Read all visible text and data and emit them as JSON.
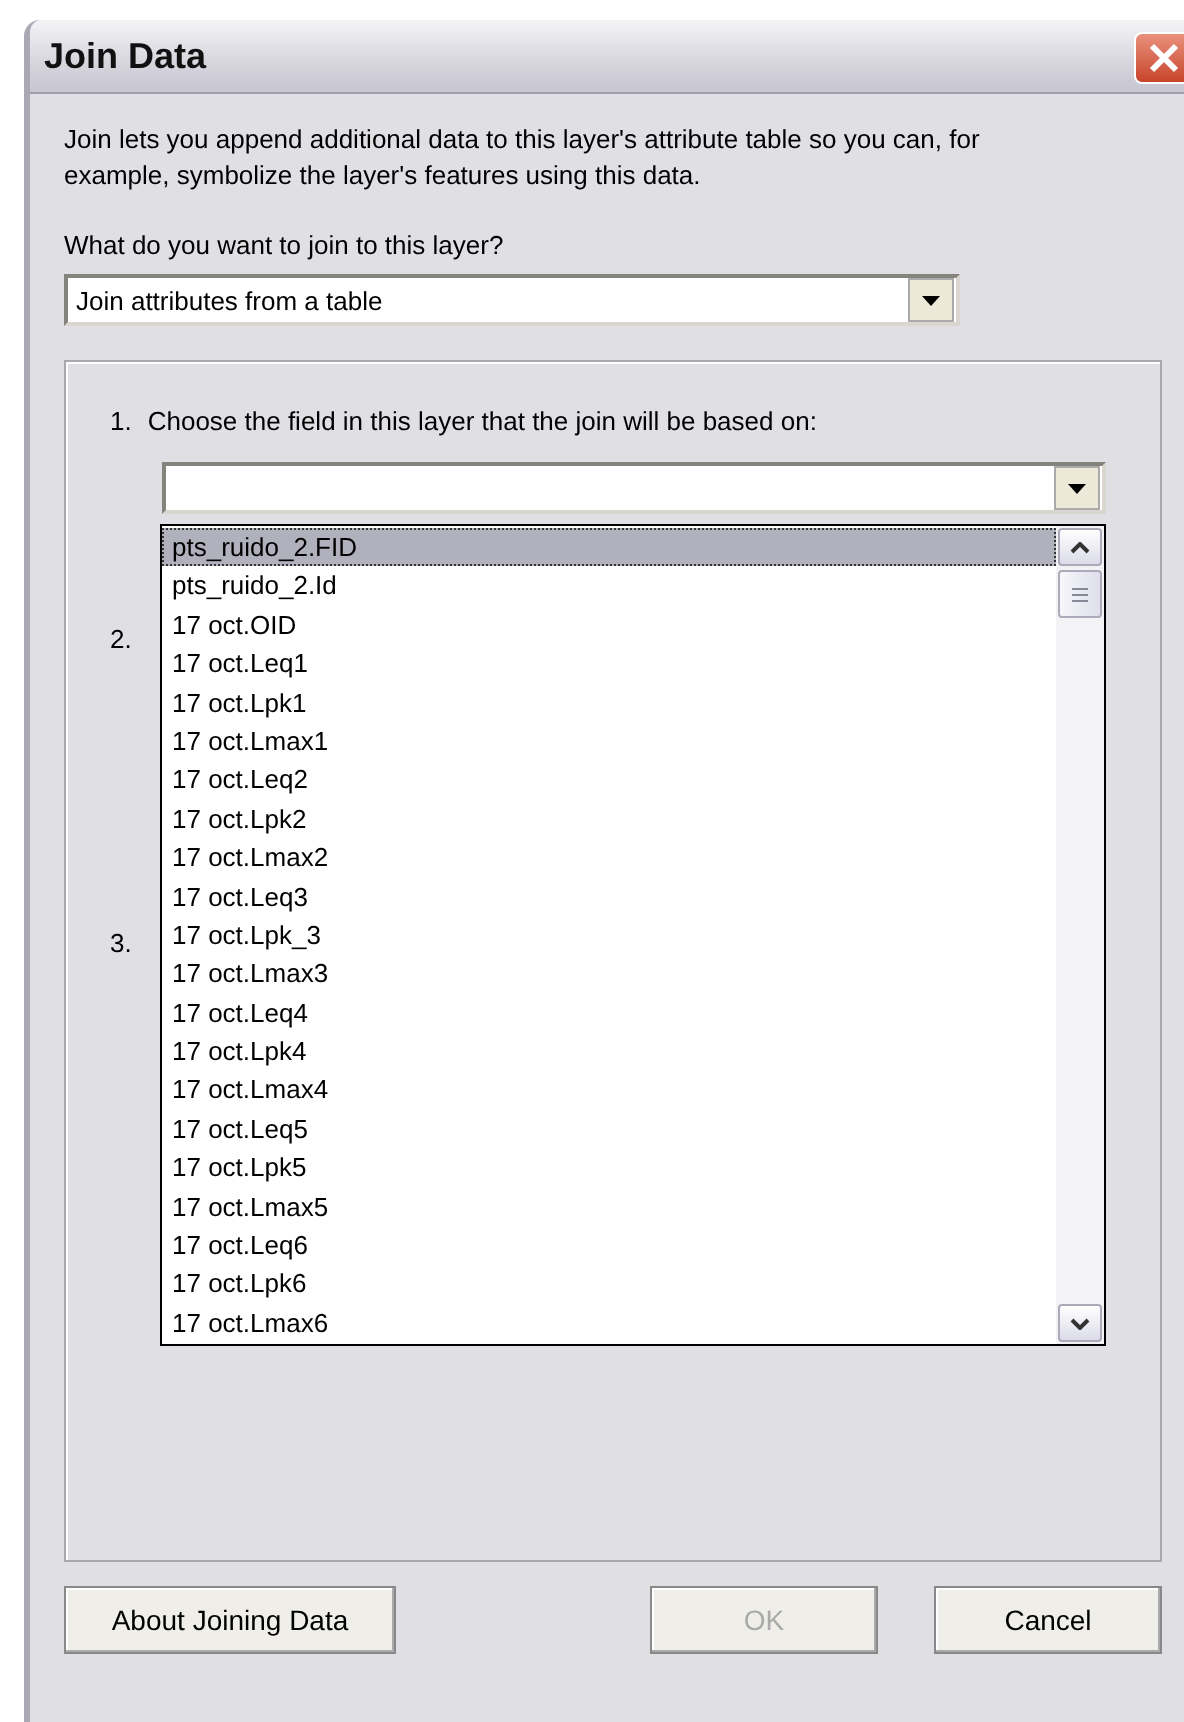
{
  "window": {
    "title": "Join Data"
  },
  "intro": "Join lets you append additional data to this layer's attribute table so you can, for example, symbolize the layer's features using this data.",
  "join_prompt": "What do you want to join to this layer?",
  "join_type": {
    "value": "Join attributes from a table"
  },
  "steps": [
    {
      "number": "1.",
      "text": "Choose the field in this layer that the join will be based on:"
    },
    {
      "number": "2."
    },
    {
      "number": "3."
    }
  ],
  "field_dropdown": {
    "expanded": true,
    "options": [
      {
        "label": "pts_ruido_2.FID",
        "selected": true
      },
      {
        "label": "pts_ruido_2.Id",
        "selected": false
      },
      {
        "label": "17 oct.OID",
        "selected": false
      },
      {
        "label": "17 oct.Leq1",
        "selected": false
      },
      {
        "label": "17 oct.Lpk1",
        "selected": false
      },
      {
        "label": "17 oct.Lmax1",
        "selected": false
      },
      {
        "label": "17 oct.Leq2",
        "selected": false
      },
      {
        "label": "17 oct.Lpk2",
        "selected": false
      },
      {
        "label": "17 oct.Lmax2",
        "selected": false
      },
      {
        "label": "17 oct.Leq3",
        "selected": false
      },
      {
        "label": "17 oct.Lpk_3",
        "selected": false
      },
      {
        "label": "17 oct.Lmax3",
        "selected": false
      },
      {
        "label": "17 oct.Leq4",
        "selected": false
      },
      {
        "label": "17 oct.Lpk4",
        "selected": false
      },
      {
        "label": "17 oct.Lmax4",
        "selected": false
      },
      {
        "label": "17 oct.Leq5",
        "selected": false
      },
      {
        "label": "17 oct.Lpk5",
        "selected": false
      },
      {
        "label": "17 oct.Lmax5",
        "selected": false
      },
      {
        "label": "17 oct.Leq6",
        "selected": false
      },
      {
        "label": "17 oct.Lpk6",
        "selected": false
      },
      {
        "label": "17 oct.Lmax6",
        "selected": false
      }
    ]
  },
  "buttons": [
    {
      "label": "About Joining Data",
      "disabled": false
    },
    {
      "label": "OK",
      "disabled": true
    },
    {
      "label": "Cancel",
      "disabled": false
    }
  ]
}
